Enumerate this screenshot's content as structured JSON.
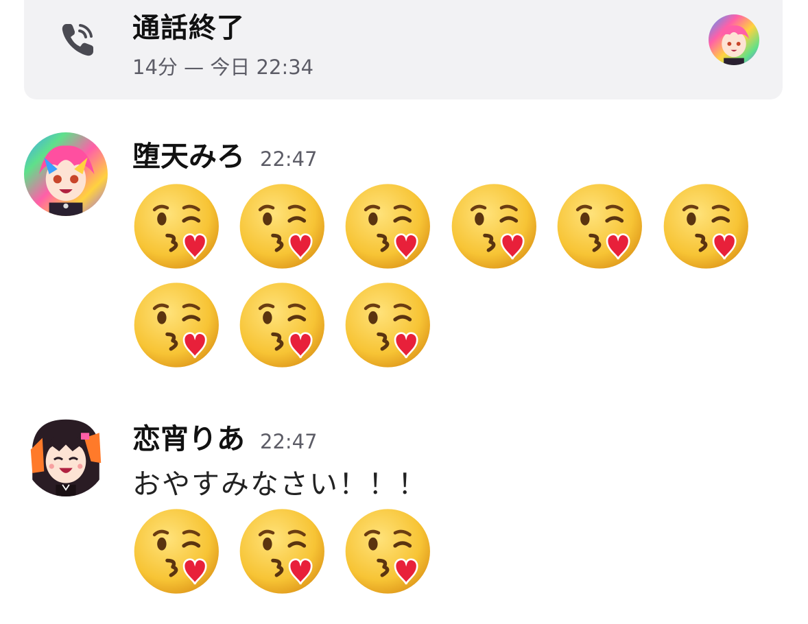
{
  "call": {
    "title": "通話終了",
    "subtitle": "14分 — 今日 22:34",
    "phone_icon": "phone-icon"
  },
  "messages": [
    {
      "author": "堕天みろ",
      "time": "22:47",
      "text": "",
      "emoji_name": "kissing-face-with-heart-emoji",
      "emoji_count": 9
    },
    {
      "author": "恋宵りあ",
      "time": "22:47",
      "text": "おやすみなさい！！！",
      "emoji_name": "kissing-face-with-heart-emoji",
      "emoji_count": 3
    }
  ],
  "colors": {
    "card_bg": "#f2f2f4",
    "secondary_text": "#5c5c66",
    "emoji_face": "#f7c435",
    "heart": "#e8203a"
  }
}
